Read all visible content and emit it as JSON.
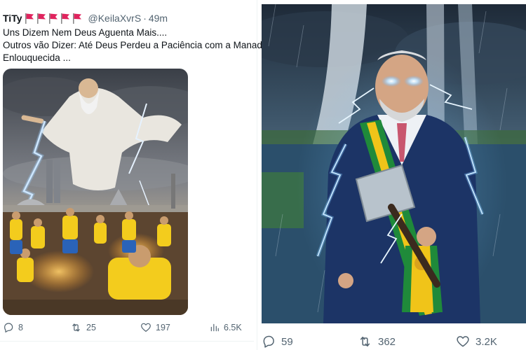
{
  "left_tweet": {
    "author": {
      "name": "TiTy",
      "flag_icons": [
        "red-flag-icon",
        "red-flag-icon",
        "red-flag-icon",
        "red-flag-icon",
        "red-flag-icon"
      ],
      "handle": "@KeilaXvrS",
      "separator": "·",
      "time": "49m"
    },
    "text_lines": [
      "Uns Dizem Nem Deus Aguenta Mais....",
      "Outros vão Dizer: Até Deus Perdeu a Paciência com a Manada",
      "Enlouquecida ..."
    ],
    "media": {
      "icon": "image-photo-icon"
    },
    "actions": {
      "replies": "8",
      "reposts": "25",
      "likes": "197",
      "views": "6.5K"
    }
  },
  "right_tweet": {
    "media": {
      "icon": "image-photo-icon"
    },
    "actions": {
      "replies": "59",
      "reposts": "362",
      "likes": "3.2K"
    }
  },
  "colors": {
    "text_primary": "#0f1419",
    "text_secondary": "#536471",
    "flag_red": "#e0245e",
    "divider": "#eff3f4"
  }
}
